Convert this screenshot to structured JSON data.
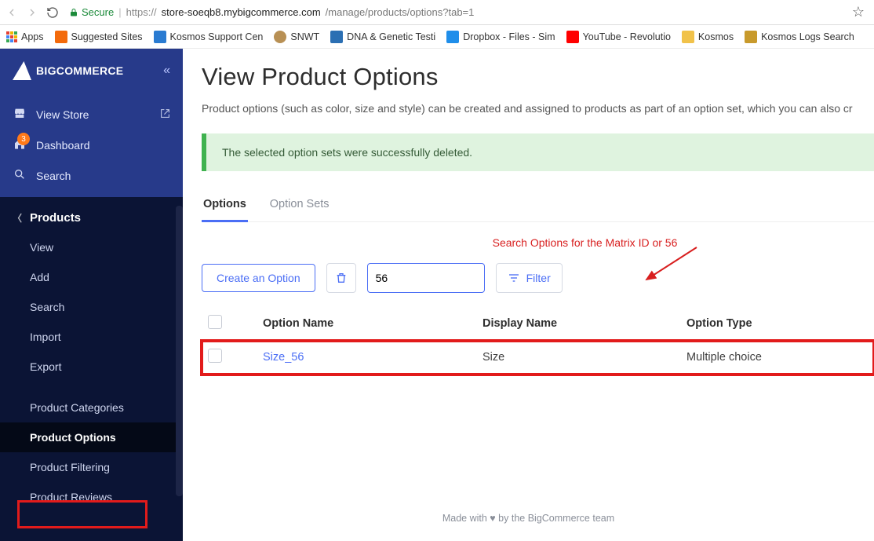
{
  "browser": {
    "secure_label": "Secure",
    "url_prefix": "https://",
    "url_host": "store-soeqb8.mybigcommerce.com",
    "url_path": "/manage/products/options?tab=1",
    "bookmarks": [
      {
        "label": "Apps",
        "icon": "apps"
      },
      {
        "label": "Suggested Sites",
        "icon": "#f36a0b"
      },
      {
        "label": "Kosmos Support Cen",
        "icon": "#2a7bd1"
      },
      {
        "label": "SNWT",
        "icon": "#b89054"
      },
      {
        "label": "DNA & Genetic Testi",
        "icon": "#2b6fb3"
      },
      {
        "label": "Dropbox - Files - Sim",
        "icon": "#1f8eea"
      },
      {
        "label": "YouTube - Revolutio",
        "icon": "#ff0000"
      },
      {
        "label": "Kosmos",
        "icon": "#f1c24a"
      },
      {
        "label": "Kosmos Logs Search",
        "icon": "#c89a2c"
      }
    ]
  },
  "brand": {
    "big": "BIG",
    "rest": "COMMERCE"
  },
  "nav": {
    "view_store": "View Store",
    "dashboard": "Dashboard",
    "dashboard_badge": "3",
    "search": "Search"
  },
  "section": {
    "title": "Products",
    "items": [
      "View",
      "Add",
      "Search",
      "Import",
      "Export"
    ],
    "items2": [
      "Product Categories",
      "Product Options",
      "Product Filtering",
      "Product Reviews"
    ],
    "active": "Product Options"
  },
  "page": {
    "title": "View Product Options",
    "desc": "Product options (such as color, size and style) can be created and assigned to products as part of an option set, which you can also cr",
    "alert": "The selected option sets were successfully deleted.",
    "tabs": [
      "Options",
      "Option Sets"
    ],
    "active_tab": "Options",
    "annotation": "Search Options for the Matrix ID or 56",
    "create_btn": "Create an Option",
    "filter_btn": "Filter",
    "search_value": "56",
    "columns": [
      "",
      "Option Name",
      "Display Name",
      "Option Type"
    ],
    "row": {
      "name": "Size_56",
      "display": "Size",
      "type": "Multiple choice"
    },
    "footer_pre": "Made with ",
    "footer_post": " by the BigCommerce team"
  }
}
